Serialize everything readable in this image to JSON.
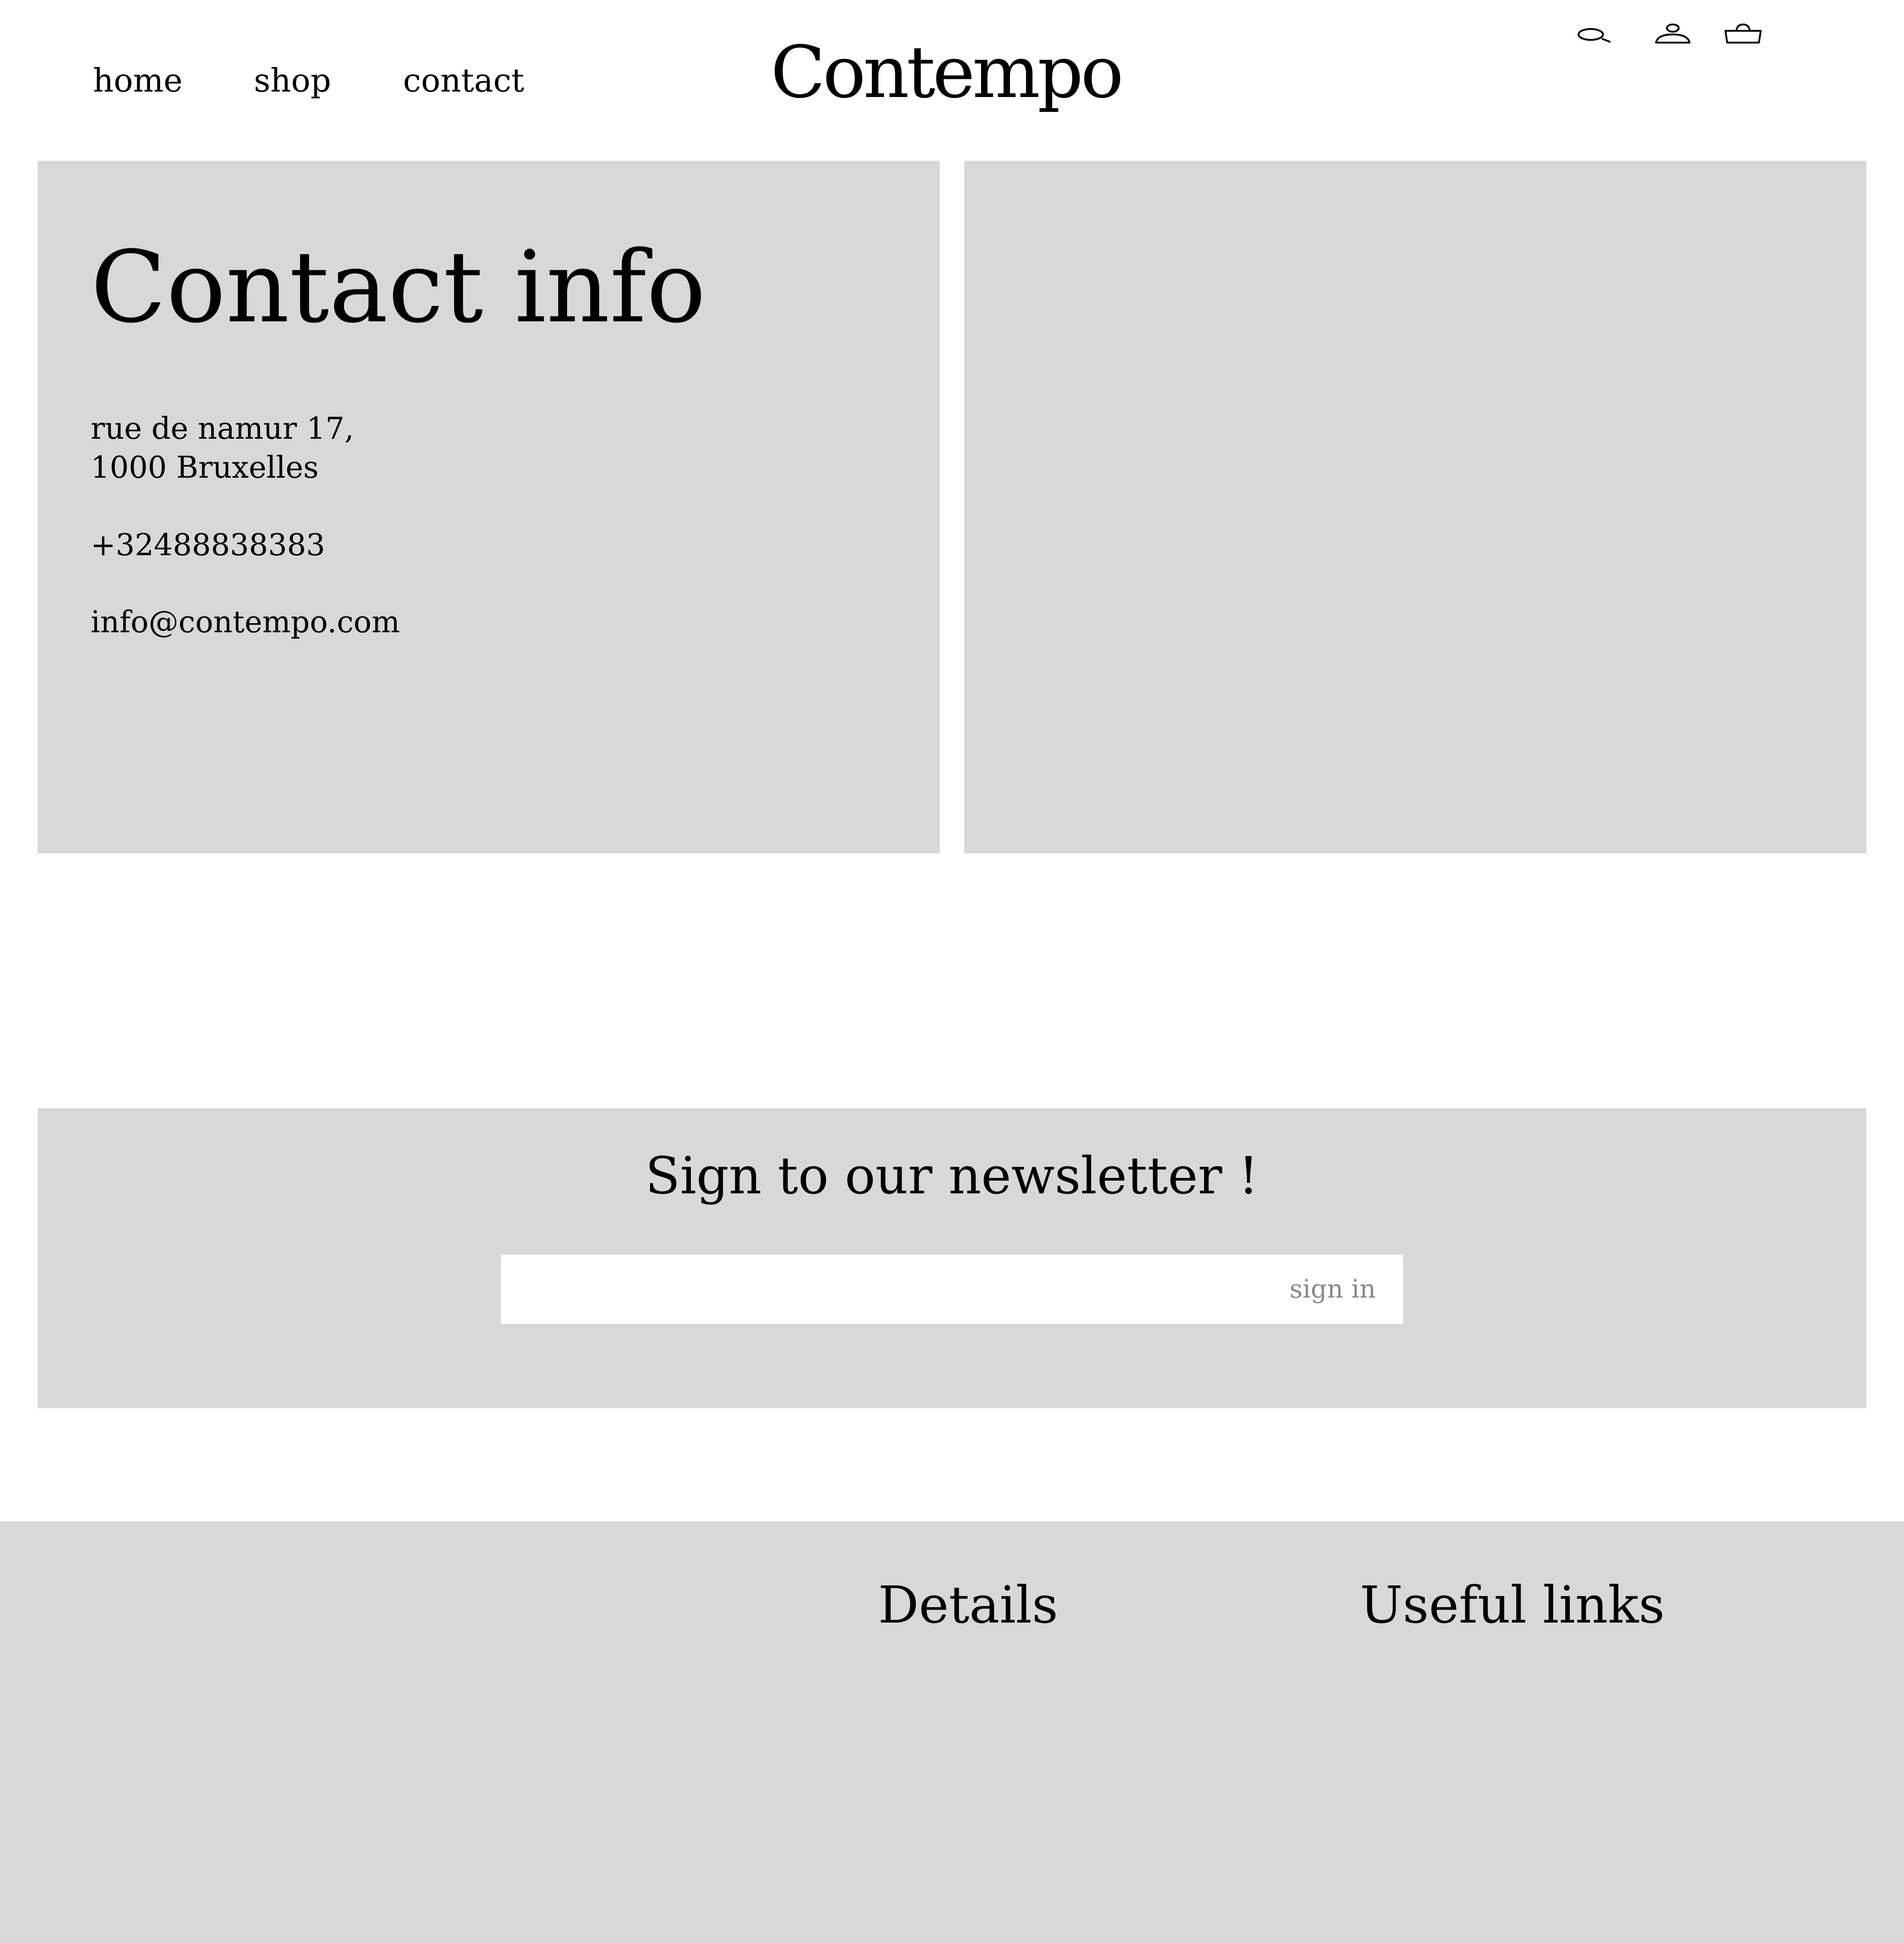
{
  "header": {
    "nav": [
      {
        "label": "home"
      },
      {
        "label": "shop"
      },
      {
        "label": "contact"
      }
    ],
    "logo_text": "Contempo",
    "icons": [
      "search-icon",
      "account-icon",
      "cart-icon"
    ]
  },
  "contact": {
    "title": "Contact info",
    "address_line1": "rue de namur 17,",
    "address_line2": "1000 Bruxelles",
    "phone": "+32488838383",
    "email": "info@contempo.com"
  },
  "newsletter": {
    "title": "Sign to our newsletter !",
    "input_value": "",
    "submit_label": "sign in"
  },
  "footer": {
    "details_heading": "Details",
    "links_heading": "Useful links"
  },
  "colors": {
    "panel_background": "#d8d8d8",
    "page_background": "#ffffff",
    "text": "#000000",
    "muted_text": "#8a8a8a"
  }
}
